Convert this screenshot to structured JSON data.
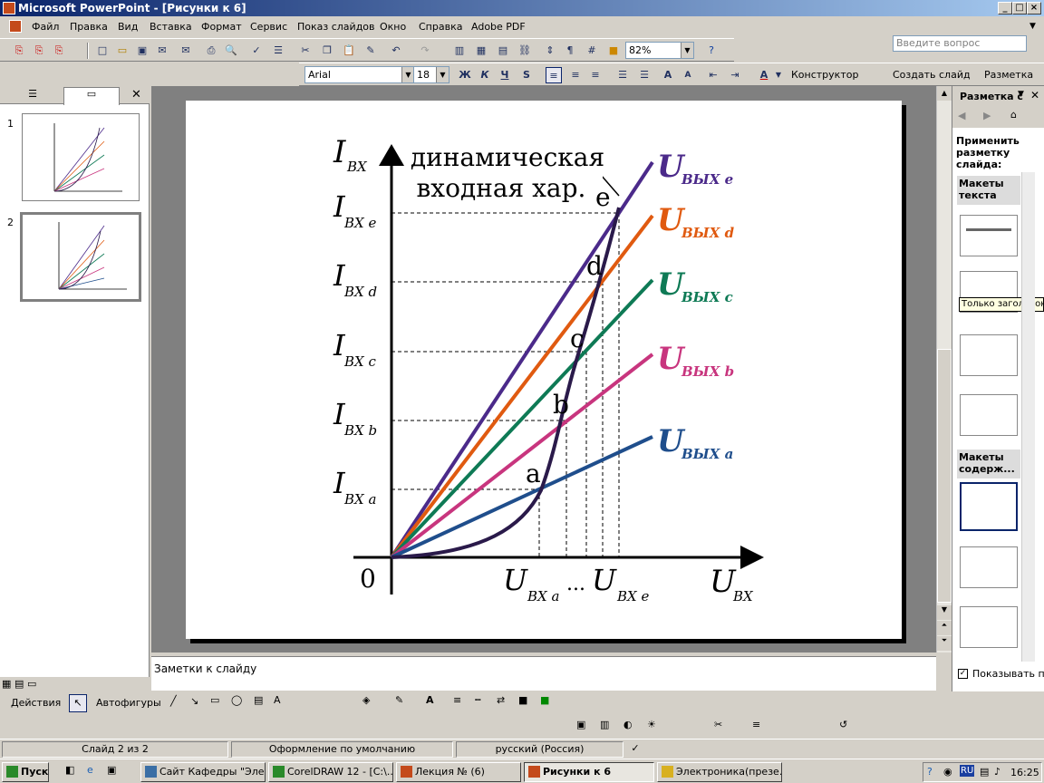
{
  "window": {
    "title": "Microsoft PowerPoint - [Рисунки к 6]"
  },
  "menu": {
    "items": [
      "Файл",
      "Правка",
      "Вид",
      "Вставка",
      "Формат",
      "Сервис",
      "Показ слайдов",
      "Окно",
      "Справка",
      "Adobe PDF"
    ],
    "ask_placeholder": "Введите вопрос"
  },
  "toolbar": {
    "zoom": "82%",
    "font": "Arial",
    "size": "18",
    "bold": "Ж",
    "italic": "К",
    "underline": "Ч",
    "shadow": "S",
    "designer": "Конструктор",
    "new_slide": "Создать слайд",
    "layout": "Разметка"
  },
  "slides_panel": {
    "nums": [
      "1",
      "2"
    ]
  },
  "slide": {
    "y_axis": "I",
    "y_axis_sub": "ВХ",
    "x_axis": "U",
    "x_axis_sub": "ВХ",
    "origin": "0",
    "dyn_label_1": "динамическая",
    "dyn_label_2": "входная хар.",
    "y_ticks": [
      {
        "main": "I",
        "sub": "ВХ e"
      },
      {
        "main": "I",
        "sub": "ВХ d"
      },
      {
        "main": "I",
        "sub": "ВХ c"
      },
      {
        "main": "I",
        "sub": "ВХ b"
      },
      {
        "main": "I",
        "sub": "ВХ a"
      }
    ],
    "x_tick_a": {
      "main": "U",
      "sub": "ВХ a"
    },
    "x_tick_dots": "...",
    "x_tick_e": {
      "main": "U",
      "sub": "ВХ e"
    },
    "points": [
      "a",
      "b",
      "c",
      "d",
      "e"
    ],
    "lines": [
      {
        "main": "U",
        "sub": "ВЫХ e",
        "color": "#4b2a8a"
      },
      {
        "main": "U",
        "sub": "ВЫХ d",
        "color": "#e05a10"
      },
      {
        "main": "U",
        "sub": "ВЫХ c",
        "color": "#0e7a55"
      },
      {
        "main": "U",
        "sub": "ВЫХ b",
        "color": "#c8357e"
      },
      {
        "main": "U",
        "sub": "ВЫХ a",
        "color": "#1f4e8c"
      }
    ],
    "curve_color": "#2a1a4a"
  },
  "notes": {
    "placeholder": "Заметки к слайду"
  },
  "taskpane": {
    "title": "Разметка с",
    "apply": "Применить разметку слайда:",
    "text_layouts": "Макеты текста",
    "tooltip": "Только заголовок",
    "content_layouts": "Макеты содерж...",
    "show_check": "Показывать пр"
  },
  "drawbar": {
    "actions": "Действия",
    "autoshapes": "Автофигуры"
  },
  "status": {
    "slide": "Слайд 2 из 2",
    "design": "Оформление по умолчанию",
    "lang": "русский (Россия)"
  },
  "taskbar": {
    "start": "Пуск",
    "tasks": [
      "Сайт Кафедры \"Эле...",
      "CorelDRAW 12 - [C:\\...",
      "Лекция № (6)",
      "Рисунки к 6",
      "Электроника(презе..."
    ],
    "tray_lang": "RU",
    "time": "16:25"
  }
}
